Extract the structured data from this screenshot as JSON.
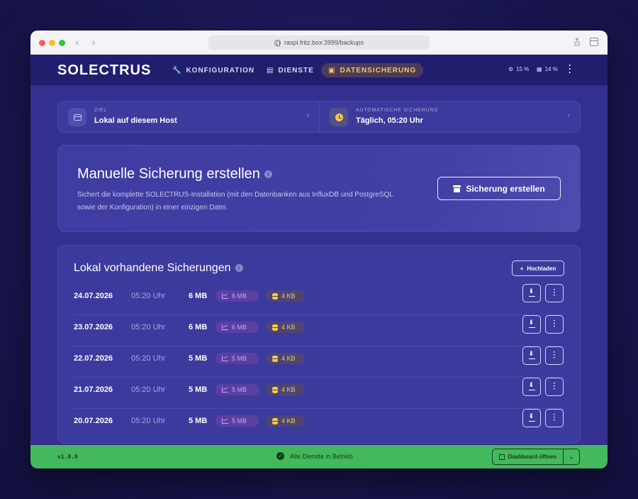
{
  "browser": {
    "url": "raspi.fritz.box:3999/backups"
  },
  "header": {
    "logo": "SOLECTRUS",
    "nav": [
      {
        "label": "KONFIGURATION"
      },
      {
        "label": "DIENSTE"
      },
      {
        "label": "DATENSICHERUNG"
      }
    ],
    "cpu": "15 %",
    "memory": "14 %"
  },
  "target": {
    "ziel_label": "ZIEL",
    "ziel_value": "Lokal auf diesem Host",
    "auto_label": "AUTOMATISCHE SICHERUNG",
    "auto_value": "Täglich, 05:20 Uhr"
  },
  "manual": {
    "title": "Manuelle Sicherung erstellen",
    "info": "i",
    "description": "Sichert die komplette SOLECTRUS-Installation (mit den Datenbanken aus InfluxDB und PostgreSQL sowie der Konfiguration) in einer einzigen Datei.",
    "button": "Sicherung erstellen"
  },
  "backups": {
    "title": "Lokal vorhandene Sicherungen",
    "info": "i",
    "upload_button": "Hochladen",
    "rows": [
      {
        "date": "24.07.2026",
        "time": "05:20 Uhr",
        "size": "6 MB",
        "influx": "6 MB",
        "postgres": "4 KB"
      },
      {
        "date": "23.07.2026",
        "time": "05:20 Uhr",
        "size": "6 MB",
        "influx": "6 MB",
        "postgres": "4 KB"
      },
      {
        "date": "22.07.2026",
        "time": "05:20 Uhr",
        "size": "5 MB",
        "influx": "5 MB",
        "postgres": "4 KB"
      },
      {
        "date": "21.07.2026",
        "time": "05:20 Uhr",
        "size": "5 MB",
        "influx": "5 MB",
        "postgres": "4 KB"
      },
      {
        "date": "20.07.2026",
        "time": "05:20 Uhr",
        "size": "5 MB",
        "influx": "5 MB",
        "postgres": "4 KB"
      }
    ]
  },
  "footer": {
    "version": "v1.0.0",
    "status": "Alle Dienste in Betrieb",
    "dashboard_button": "Dashboard öffnen"
  },
  "colors": {
    "accent": "#f6c94a",
    "background": "#34308f",
    "footer": "#44b85c"
  }
}
